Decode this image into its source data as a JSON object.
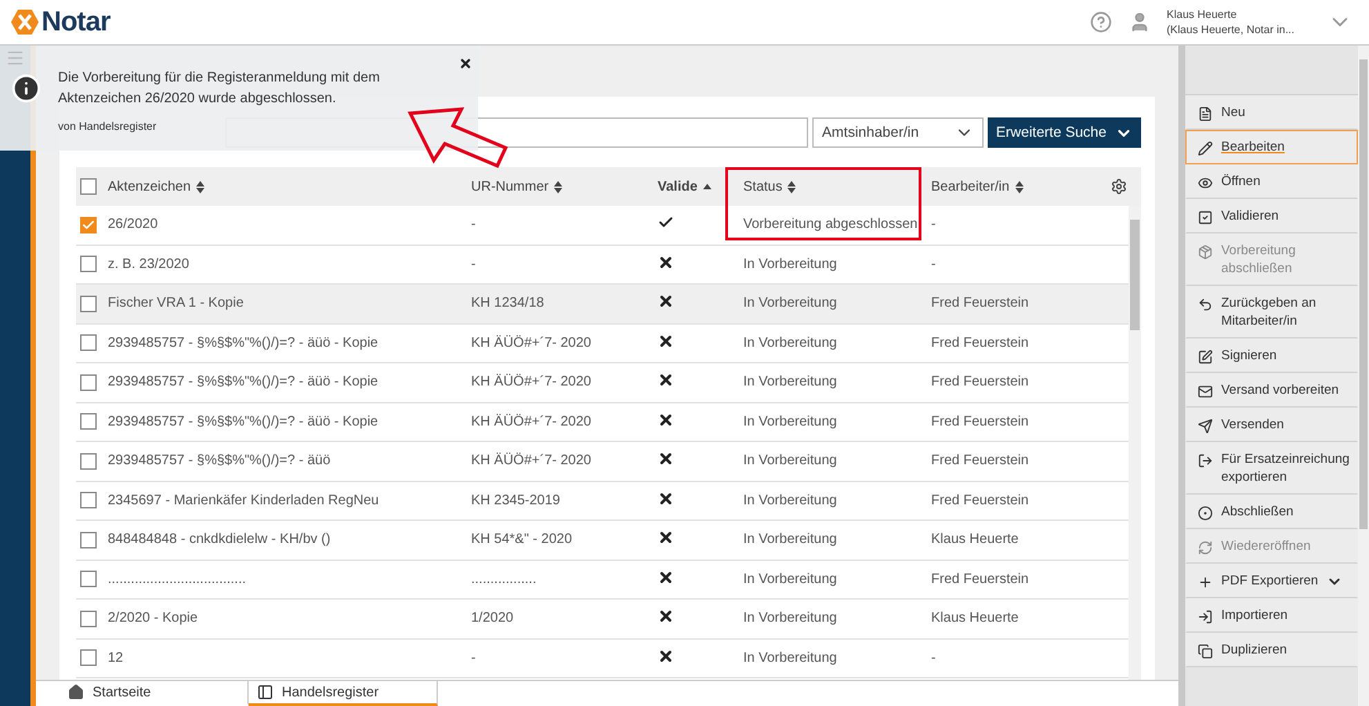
{
  "header": {
    "logo_text": "Notar",
    "user_name": "Klaus Heuerte",
    "user_role": "(Klaus Heuerte, Notar in..."
  },
  "notification": {
    "message": "Die Vorbereitung für die Registeranmeldung mit dem Aktenzeichen 26/2020 wurde abgeschlossen.",
    "source": "von Handelsregister"
  },
  "page": {
    "filter_select": "Amtsinhaber/in",
    "search_button": "Erweiterte Suche"
  },
  "table": {
    "columns": [
      {
        "label": "Aktenzeichen",
        "sorted": false
      },
      {
        "label": "UR-Nummer",
        "sorted": false
      },
      {
        "label": "Valide",
        "sorted": true
      },
      {
        "label": "Status",
        "sorted": false
      },
      {
        "label": "Bearbeiter/in",
        "sorted": false
      }
    ],
    "all_checked": false,
    "rows": [
      {
        "aktenzeichen": "26/2020",
        "ur_nummer": "-",
        "valid": true,
        "status": "Vorbereitung abgeschlossen",
        "bearbeiter": "-",
        "checked": true,
        "highlighted": false
      },
      {
        "aktenzeichen": "z. B. 23/2020",
        "ur_nummer": "-",
        "valid": false,
        "status": "In Vorbereitung",
        "bearbeiter": "-",
        "checked": false,
        "highlighted": false
      },
      {
        "aktenzeichen": "Fischer VRA 1 - Kopie",
        "ur_nummer": "KH 1234/18",
        "valid": false,
        "status": "In Vorbereitung",
        "bearbeiter": "Fred Feuerstein",
        "checked": false,
        "highlighted": true
      },
      {
        "aktenzeichen": "2939485757 - §%§$%\"%()/)=? - äüö - Kopie",
        "ur_nummer": "KH ÄÜÖ#+´7- 2020",
        "valid": false,
        "status": "In Vorbereitung",
        "bearbeiter": "Fred Feuerstein",
        "checked": false,
        "highlighted": false
      },
      {
        "aktenzeichen": "2939485757 - §%§$%\"%()/)=? - äüö - Kopie",
        "ur_nummer": "KH ÄÜÖ#+´7- 2020",
        "valid": false,
        "status": "In Vorbereitung",
        "bearbeiter": "Fred Feuerstein",
        "checked": false,
        "highlighted": false
      },
      {
        "aktenzeichen": "2939485757 - §%§$%\"%()/)=? - äüö - Kopie",
        "ur_nummer": "KH ÄÜÖ#+´7- 2020",
        "valid": false,
        "status": "In Vorbereitung",
        "bearbeiter": "Fred Feuerstein",
        "checked": false,
        "highlighted": false
      },
      {
        "aktenzeichen": "2939485757 - §%§$%\"%()/)=? - äüö",
        "ur_nummer": "KH ÄÜÖ#+´7- 2020",
        "valid": false,
        "status": "In Vorbereitung",
        "bearbeiter": "Fred Feuerstein",
        "checked": false,
        "highlighted": false
      },
      {
        "aktenzeichen": "2345697 - Marienkäfer Kinderladen RegNeu",
        "ur_nummer": "KH 2345-2019",
        "valid": false,
        "status": "In Vorbereitung",
        "bearbeiter": "Fred Feuerstein",
        "checked": false,
        "highlighted": false
      },
      {
        "aktenzeichen": "848484848 - cnkdkdielelw - KH/bv ()",
        "ur_nummer": "KH 54*&\" - 2020",
        "valid": false,
        "status": "In Vorbereitung",
        "bearbeiter": "Klaus Heuerte",
        "checked": false,
        "highlighted": false
      },
      {
        "aktenzeichen": "....................................",
        "ur_nummer": ".................",
        "valid": false,
        "status": "In Vorbereitung",
        "bearbeiter": "Fred Feuerstein",
        "checked": false,
        "highlighted": false
      },
      {
        "aktenzeichen": "2/2020 - Kopie",
        "ur_nummer": "1/2020",
        "valid": false,
        "status": "In Vorbereitung",
        "bearbeiter": "Klaus Heuerte",
        "checked": false,
        "highlighted": false
      },
      {
        "aktenzeichen": "12",
        "ur_nummer": "-",
        "valid": false,
        "status": "In Vorbereitung",
        "bearbeiter": "-",
        "checked": false,
        "highlighted": false
      }
    ]
  },
  "actions": [
    {
      "label": "Neu",
      "kind": "button",
      "disabled": false,
      "selected": false
    },
    {
      "label": "Bearbeiten",
      "kind": "button",
      "disabled": false,
      "selected": true
    },
    {
      "label": "Öffnen",
      "kind": "button",
      "disabled": false,
      "selected": false
    },
    {
      "label": "Validieren",
      "kind": "button",
      "disabled": false,
      "selected": false
    },
    {
      "label": "Vorbereitung abschließen",
      "kind": "button",
      "disabled": true,
      "selected": false
    },
    {
      "label": "Zurückgeben an Mitarbeiter/in",
      "kind": "button",
      "disabled": false,
      "selected": false
    },
    {
      "label": "Signieren",
      "kind": "button",
      "disabled": false,
      "selected": false
    },
    {
      "label": "Versand vorbereiten",
      "kind": "button",
      "disabled": false,
      "selected": false
    },
    {
      "label": "Versenden",
      "kind": "button",
      "disabled": false,
      "selected": false
    },
    {
      "label": "Für Ersatzeinreichung exportieren",
      "kind": "button",
      "disabled": false,
      "selected": false
    },
    {
      "label": "Abschließen",
      "kind": "button",
      "disabled": false,
      "selected": false
    },
    {
      "label": "Wiedereröffnen",
      "kind": "button",
      "disabled": true,
      "selected": false
    },
    {
      "label": "PDF Exportieren",
      "kind": "dropdown",
      "disabled": false,
      "selected": false
    },
    {
      "label": "Importieren",
      "kind": "button",
      "disabled": false,
      "selected": false
    },
    {
      "label": "Duplizieren",
      "kind": "button",
      "disabled": false,
      "selected": false
    }
  ],
  "tabs": [
    {
      "label": "Startseite",
      "selected": false
    },
    {
      "label": "Handelsregister",
      "selected": true
    }
  ]
}
